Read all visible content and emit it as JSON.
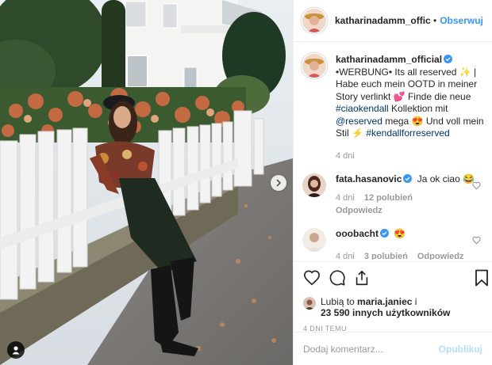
{
  "header": {
    "username": "katharinadamm_offic",
    "separator": "•",
    "follow_label": "Obserwuj"
  },
  "caption": {
    "username": "katharinadamm_official",
    "text_1": "•WERBUNG• Its all reserved ",
    "emoji_sparkles": "✨",
    "text_2": " | Habe euch mein OOTD in meiner Story verlinkt ",
    "emoji_heart": "💕",
    "text_3": " Finde die neue ",
    "hashtag_1": "#ciaokendall",
    "text_4": " Kollektion mit ",
    "mention": "@reserved",
    "text_5": " mega ",
    "emoji_smile": "😍",
    "text_6": " Und voll mein Stil ",
    "emoji_bolt": "⚡",
    "text_7": " ",
    "hashtag_2": "#kendallforreserved",
    "time": "4 dni"
  },
  "comments": [
    {
      "username": "fata.hasanovic",
      "text": "Ja ok ciao 😂",
      "time": "4 dni",
      "likes": "12 polubień",
      "reply_label": "Odpowiedz"
    },
    {
      "username": "ooobacht",
      "text": "😍",
      "time": "4 dni",
      "likes": "3 polubień",
      "reply_label": "Odpowiedz"
    }
  ],
  "likes": {
    "prefix": "Lubią to ",
    "user": "maria.janiec",
    "suffix": " i",
    "count_text": "23 590 innych użytkowników"
  },
  "timestamp": "4 DNI TEMU",
  "add_comment": {
    "placeholder": "Dodaj komentarz...",
    "post_label": "Opublikuj"
  },
  "colors": {
    "link_blue": "#3897f0",
    "hashtag_blue": "#003569",
    "verified": "#3897f0",
    "muted": "#999999"
  }
}
